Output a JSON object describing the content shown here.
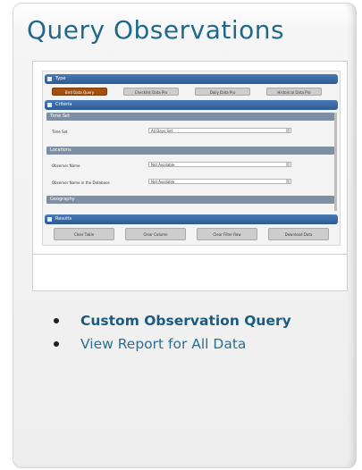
{
  "title": "Query Observations",
  "preview": {
    "sections": {
      "type": "Type",
      "criteria": "Criteria",
      "results": "Results"
    },
    "type_buttons": [
      "Bird Data Query",
      "Checklist Data Pro",
      "Daily Data Pro",
      "Historical Data Pro"
    ],
    "subsections": {
      "time": "Time Set",
      "locations": "Locations",
      "geography": "Geography"
    },
    "rows": [
      {
        "label": "Time Set",
        "value": "All Days Set"
      },
      {
        "label": "Observer Name",
        "value": "Not Available"
      },
      {
        "label": "Observer Name in the Database",
        "value": "Not Available"
      }
    ],
    "result_buttons": [
      "Clear Table",
      "Clear Column",
      "Clear Filter Row",
      "Download Data"
    ]
  },
  "links": [
    {
      "label": "Custom Observation Query"
    },
    {
      "label": "View Report for All Data"
    }
  ]
}
